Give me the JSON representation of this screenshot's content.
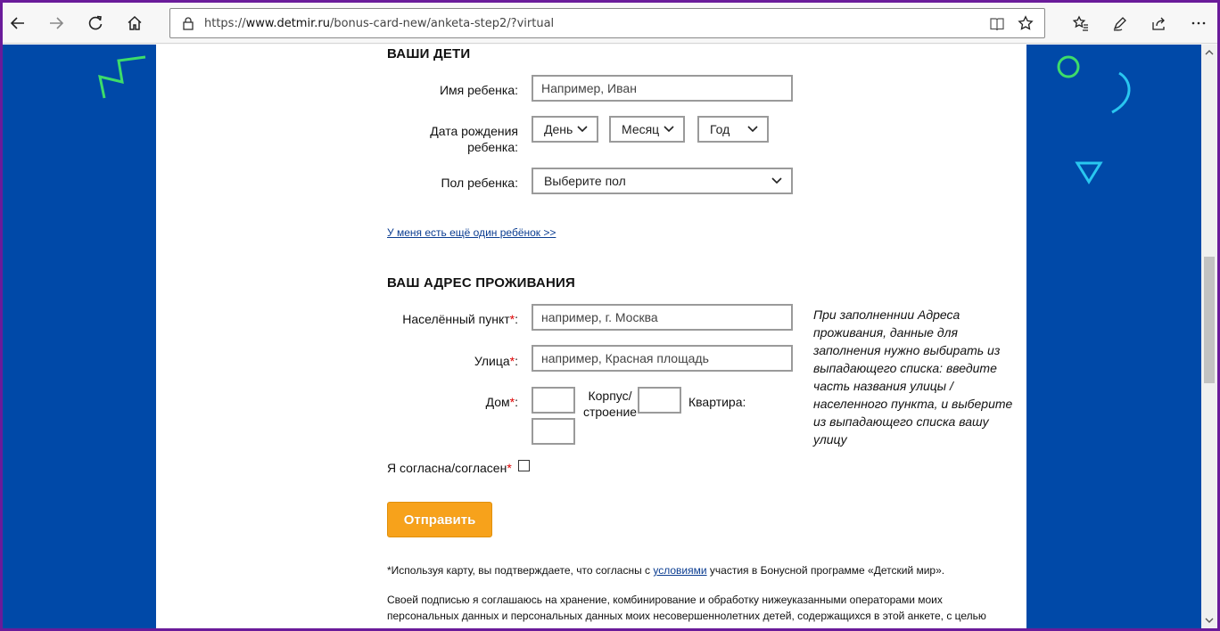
{
  "browser": {
    "url_prefix": "https://",
    "url_domain": "www.detmir.ru",
    "url_path": "/bonus-card-new/anketa-step2/?virtual"
  },
  "children": {
    "title": "ВАШИ ДЕТИ",
    "name_label": "Имя ребенка:",
    "name_placeholder": "Например, Иван",
    "birth_label_1": "Дата рождения",
    "birth_label_2": "ребенка:",
    "day": "День",
    "month": "Месяц",
    "year": "Год",
    "gender_label": "Пол ребенка:",
    "gender_value": "Выберите пол",
    "add_child_link": "У меня есть ещё один ребёнок >>"
  },
  "address": {
    "title": "ВАШ АДРЕС ПРОЖИВАНИЯ",
    "city_label": "Населённый пункт",
    "city_placeholder": "например, г. Москва",
    "street_label": "Улица",
    "street_placeholder": "например, Красная площадь",
    "house_label": "Дом",
    "building_label_1": "Корпус/",
    "building_label_2": "строение",
    "apartment_label": "Квартира:",
    "required_mark": "*",
    "colon": ":",
    "hint": "При заполненнии Адреса проживания, данные для заполнения нужно выбирать из выпадающего списка: введите часть названия улицы / населенного пункта, и выберите из выпадающего списка вашу улицу"
  },
  "consent": {
    "label": "Я согласна/согласен"
  },
  "submit_label": "Отправить",
  "footer": {
    "terms_prefix": "*Используя карту, вы подтверждаете, что согласны с ",
    "terms_link": "условиями",
    "terms_suffix": " участия в Бонусной программе «Детский мир».",
    "paragraph": "Своей подписью я соглашаюсь на хранение, комбинирование и обработку нижеуказанными операторами моих персональных данных и персональных данных моих несовершеннолетних детей, содержащихся в этой анкете, с целью"
  },
  "colors": {
    "background_blue": "#0049a8",
    "button_orange": "#f7a21b",
    "frame_purple": "#6a1b9a"
  }
}
